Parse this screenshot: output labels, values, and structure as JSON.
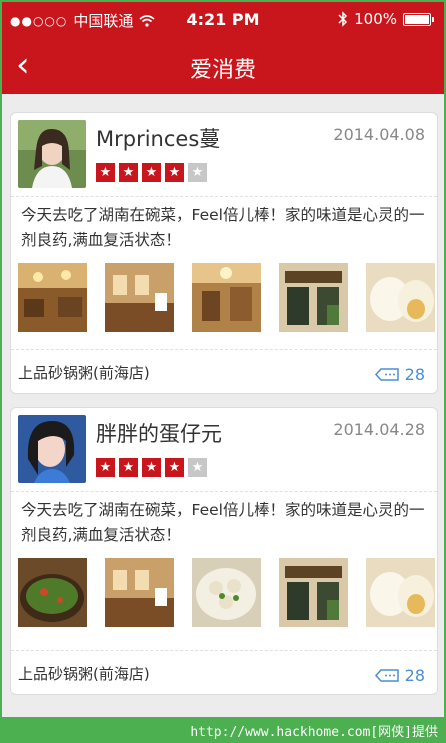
{
  "status_bar": {
    "signal": "●●○○○",
    "carrier": "中国联通",
    "time": "4:21 PM",
    "battery": "100%"
  },
  "nav": {
    "back": "‹",
    "title": "爱消费"
  },
  "reviews": [
    {
      "user": "Mrprinces蔓",
      "date": "2014.04.08",
      "rating": 4,
      "max_rating": 5,
      "text": "今天去吃了湖南在碗菜，Feel倍儿棒！家的味道是心灵的一剂良药,满血复活状态！",
      "shop": "上品砂锅粥(前海店)",
      "comments": "28"
    },
    {
      "user": "胖胖的蛋仔元",
      "date": "2014.04.28",
      "rating": 4,
      "max_rating": 5,
      "text": "今天去吃了湖南在碗菜，Feel倍儿棒！家的味道是心灵的一剂良药,满血复活状态！",
      "shop": "上品砂锅粥(前海店)",
      "comments": "28"
    }
  ],
  "watermark": "http://www.hackhome.com[网侠]提供",
  "colors": {
    "brand": "#c9161d",
    "link": "#4a8fd6",
    "frame": "#4caf50"
  }
}
